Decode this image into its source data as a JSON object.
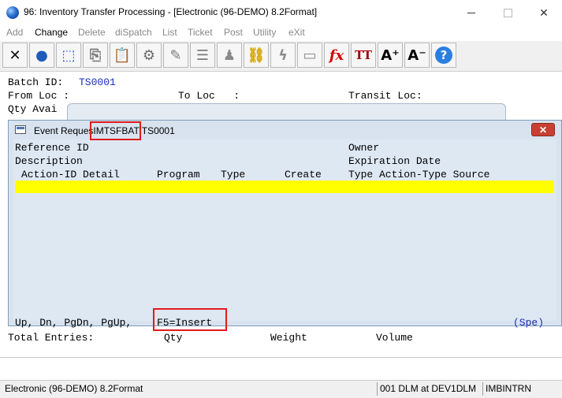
{
  "window": {
    "title": "96: Inventory Transfer Processing - [Electronic (96-DEMO) 8.2Format]",
    "minimize": "",
    "maximize": "",
    "close": "✕"
  },
  "menu": [
    "Add",
    "Change",
    "Delete",
    "diSpatch",
    "List",
    "Ticket",
    "Post",
    "Utility",
    "eXit"
  ],
  "toolbar": [
    {
      "icon": "cancel-x-icon",
      "glyph": "✕",
      "color": "#111111"
    },
    {
      "icon": "globe-icon",
      "glyph": "●",
      "color": "#1e5bb8"
    },
    {
      "icon": "select-box-icon",
      "glyph": "⬚",
      "color": "#2b4fd8"
    },
    {
      "icon": "copy-icon",
      "glyph": "⎘",
      "color": "#7a7a7a"
    },
    {
      "icon": "paste-icon",
      "glyph": "📋",
      "color": "#8a6a20"
    },
    {
      "icon": "settings-gear-icon",
      "glyph": "⚙",
      "color": "#6a6a6a"
    },
    {
      "icon": "edit-pencil-icon",
      "glyph": "✎",
      "color": "#7a7a7a"
    },
    {
      "icon": "list-icon",
      "glyph": "☰",
      "color": "#7a7a7a"
    },
    {
      "icon": "users-icon",
      "glyph": "♟",
      "color": "#8a8a8a"
    },
    {
      "icon": "link-chain-icon",
      "glyph": "⛓",
      "color": "#d4a600"
    },
    {
      "icon": "lightning-icon",
      "glyph": "ϟ",
      "color": "#8a8a8a"
    },
    {
      "icon": "screen-arrow-icon",
      "glyph": "▭",
      "color": "#8a8a8a"
    },
    {
      "icon": "function-fx-icon",
      "glyph": "fx",
      "color": "#d40000"
    },
    {
      "icon": "font-type-icon",
      "glyph": "TT",
      "color": "#a00000"
    },
    {
      "icon": "font-larger-icon",
      "glyph": "A⁺",
      "color": "#000000"
    },
    {
      "icon": "font-smaller-icon",
      "glyph": "A⁻",
      "color": "#000000"
    },
    {
      "icon": "help-icon",
      "glyph": "?",
      "color": "#ffffff"
    }
  ],
  "batch": {
    "label": "Batch ID:",
    "value": "TS0001"
  },
  "from_loc_label": "From Loc :",
  "to_loc_label": "To Loc   :",
  "transit_loc_label": "Transit Loc:",
  "qty_avail_label": "Qty Avai",
  "totals": {
    "entries": "Total Entries:",
    "qty": "Qty",
    "weight": "Weight",
    "volume": "Volume"
  },
  "dialog": {
    "title_prefix": "Event Reques",
    "title_code": "IMTSFBAT",
    "title_suffix": "TS0001",
    "close": "✕",
    "reference_id": "Reference ID",
    "owner": "Owner",
    "description": "Description",
    "expiration_date": "Expiration Date",
    "columns": {
      "action_id_detail": "Action-ID Detail",
      "program": "Program",
      "type": "Type",
      "create": "Create",
      "type_action_type_source": "Type Action-Type Source"
    },
    "footer_keys": "Up, Dn, PgDn, PgUp,",
    "footer_f5": "F5=Insert",
    "footer_spe": "(Spe)"
  },
  "status": {
    "company": "Electronic (96-DEMO) 8.2Format",
    "session": "001 DLM at DEV1DLM",
    "program": "IMBINTRN"
  }
}
